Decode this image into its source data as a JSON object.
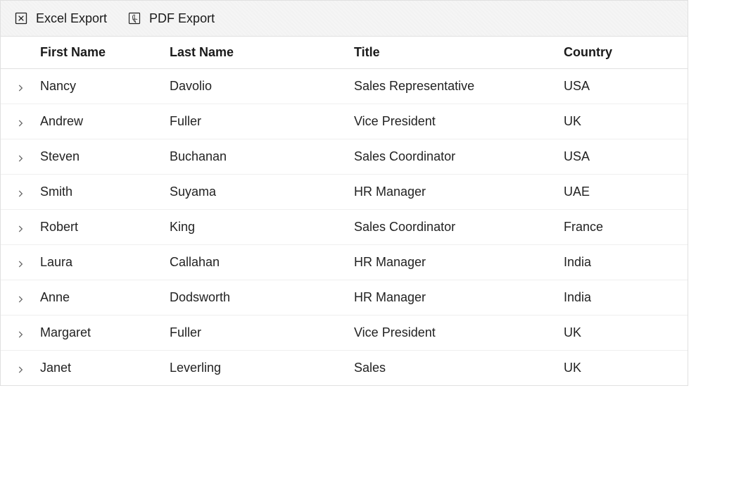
{
  "toolbar": {
    "excel_export_label": "Excel Export",
    "pdf_export_label": "PDF Export"
  },
  "columns": {
    "first_name": "First Name",
    "last_name": "Last Name",
    "title": "Title",
    "country": "Country"
  },
  "rows": [
    {
      "first_name": "Nancy",
      "last_name": "Davolio",
      "title": "Sales Representative",
      "country": "USA"
    },
    {
      "first_name": "Andrew",
      "last_name": "Fuller",
      "title": "Vice President",
      "country": "UK"
    },
    {
      "first_name": "Steven",
      "last_name": "Buchanan",
      "title": "Sales Coordinator",
      "country": "USA"
    },
    {
      "first_name": "Smith",
      "last_name": "Suyama",
      "title": "HR Manager",
      "country": "UAE"
    },
    {
      "first_name": "Robert",
      "last_name": "King",
      "title": "Sales Coordinator",
      "country": "France"
    },
    {
      "first_name": "Laura",
      "last_name": "Callahan",
      "title": "HR Manager",
      "country": "India"
    },
    {
      "first_name": "Anne",
      "last_name": "Dodsworth",
      "title": "HR Manager",
      "country": "India"
    },
    {
      "first_name": "Margaret",
      "last_name": "Fuller",
      "title": "Vice President",
      "country": "UK"
    },
    {
      "first_name": "Janet",
      "last_name": "Leverling",
      "title": "Sales",
      "country": "UK"
    }
  ]
}
